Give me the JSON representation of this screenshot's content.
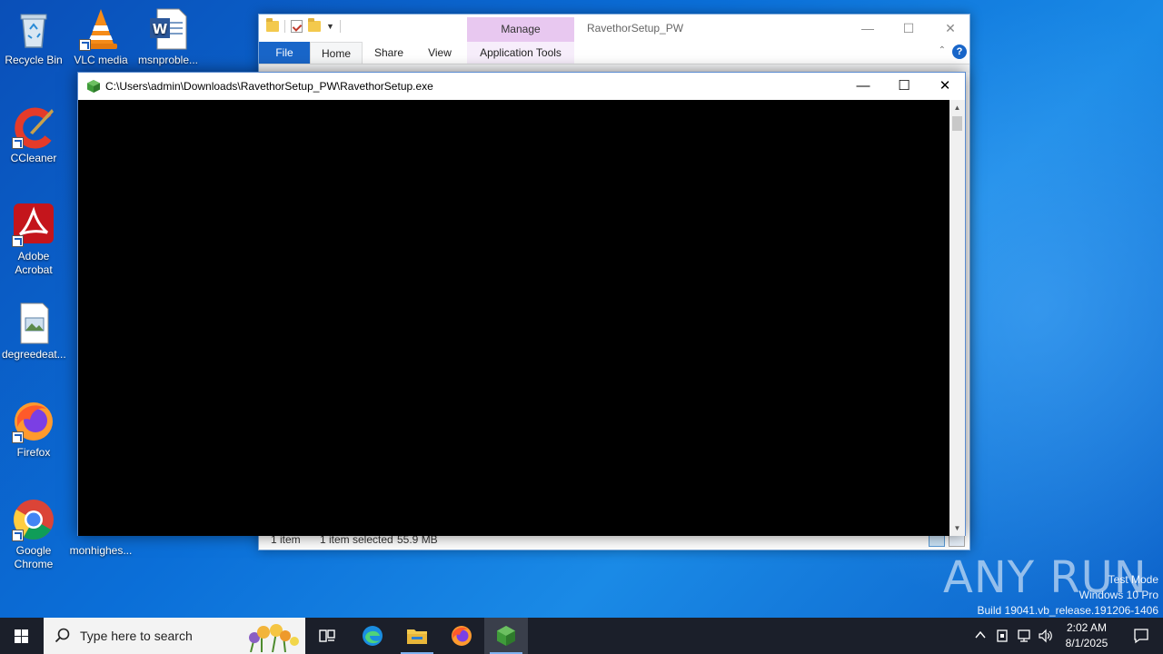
{
  "desktop": {
    "icons": [
      {
        "label": "Recycle Bin"
      },
      {
        "label": "VLC media"
      },
      {
        "label": "msnproble..."
      },
      {
        "label": "CCleaner"
      },
      {
        "label": "Adobe Acrobat"
      },
      {
        "label": "degreedeat..."
      },
      {
        "label": "Firefox"
      },
      {
        "label": "Google Chrome"
      },
      {
        "label": "monhighes..."
      }
    ]
  },
  "explorer": {
    "title": "RavethorSetup_PW",
    "manage_tab": "Manage",
    "tabs": {
      "file": "File",
      "home": "Home",
      "share": "Share",
      "view": "View",
      "app_tools": "Application Tools"
    },
    "help": "?",
    "status": {
      "items": "1 item",
      "selected": "1 item selected",
      "size": "55.9 MB"
    }
  },
  "console": {
    "title": "C:\\Users\\admin\\Downloads\\RavethorSetup_PW\\RavethorSetup.exe"
  },
  "watermark": {
    "logo": "ANY RUN",
    "line1": "Test Mode",
    "line2": "Windows 10 Pro",
    "line3": "Build 19041.vb_release.191206-1406"
  },
  "taskbar": {
    "search_placeholder": "Type here to search",
    "time": "2:02 AM",
    "date": "8/1/2025"
  },
  "colors": {
    "accent": "#1966c9",
    "manage_tab": "#e8c8f0",
    "taskbar": "#1b1f2a"
  }
}
